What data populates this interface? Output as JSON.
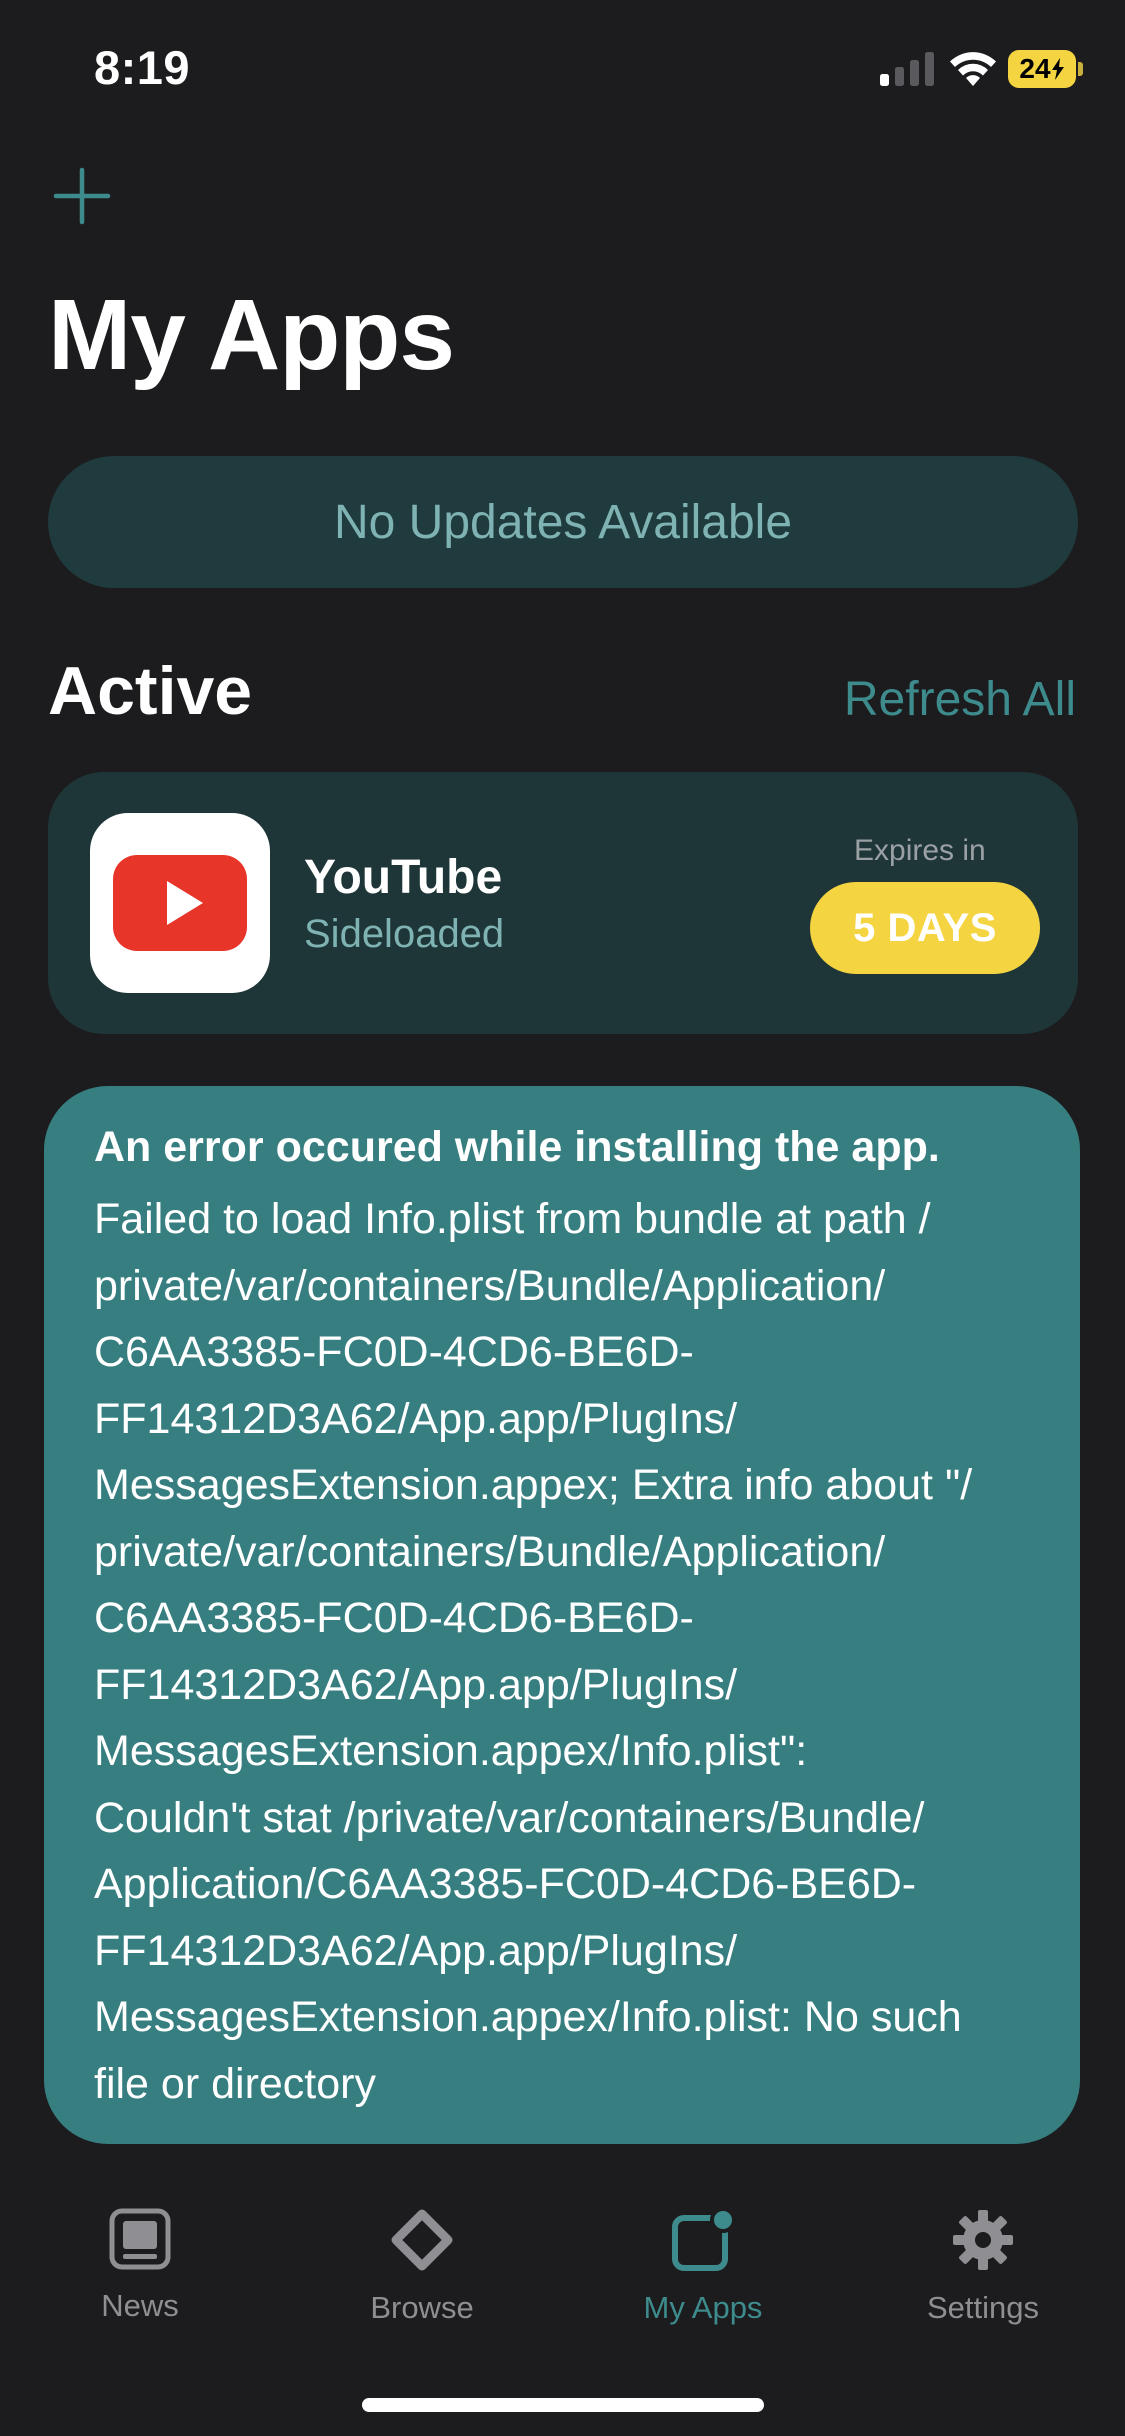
{
  "status_bar": {
    "time": "8:19",
    "battery": "24",
    "icons": [
      "cellular-signal-icon",
      "wifi-icon",
      "battery-charging-icon"
    ]
  },
  "header": {
    "add_icon": "plus-icon",
    "title": "My Apps"
  },
  "updates_banner": {
    "label": "No Updates Available"
  },
  "active_section": {
    "title": "Active",
    "refresh_label": "Refresh All"
  },
  "app": {
    "name": "YouTube",
    "subtitle": "Sideloaded",
    "icon": "youtube-icon",
    "expires_label": "Expires in",
    "expires_value": "5 DAYS"
  },
  "error": {
    "title": "An error occured while installing the app.",
    "lines": [
      "Failed to load Info.plist from bundle at path /",
      "private/var/containers/Bundle/Application/",
      "C6AA3385-FC0D-4CD6-BE6D-",
      "FF14312D3A62/App.app/PlugIns/",
      "MessagesExtension.appex; Extra info about \"/",
      "private/var/containers/Bundle/Application/",
      "C6AA3385-FC0D-4CD6-BE6D-",
      "FF14312D3A62/App.app/PlugIns/",
      "MessagesExtension.appex/Info.plist\":",
      "Couldn't stat /private/var/containers/Bundle/",
      "Application/C6AA3385-FC0D-4CD6-BE6D-",
      "FF14312D3A62/App.app/PlugIns/",
      "MessagesExtension.appex/Info.plist: No such",
      "file or directory"
    ]
  },
  "tab_bar": {
    "tabs": [
      {
        "label": "News",
        "icon": "news-icon",
        "active": false
      },
      {
        "label": "Browse",
        "icon": "browse-icon",
        "active": false
      },
      {
        "label": "My Apps",
        "icon": "my-apps-icon",
        "active": true
      },
      {
        "label": "Settings",
        "icon": "gear-icon",
        "active": false
      }
    ]
  },
  "colors": {
    "background": "#1c1c1e",
    "accent": "#3e8b8d",
    "banner_bg": "#1f3b3d",
    "banner_text": "#7fb3b3",
    "card_bg": "#1f3638",
    "error_bg": "#377e80",
    "expires_badge": "#f5d442",
    "battery": "#f5d442",
    "tab_inactive": "#8e8e93"
  }
}
